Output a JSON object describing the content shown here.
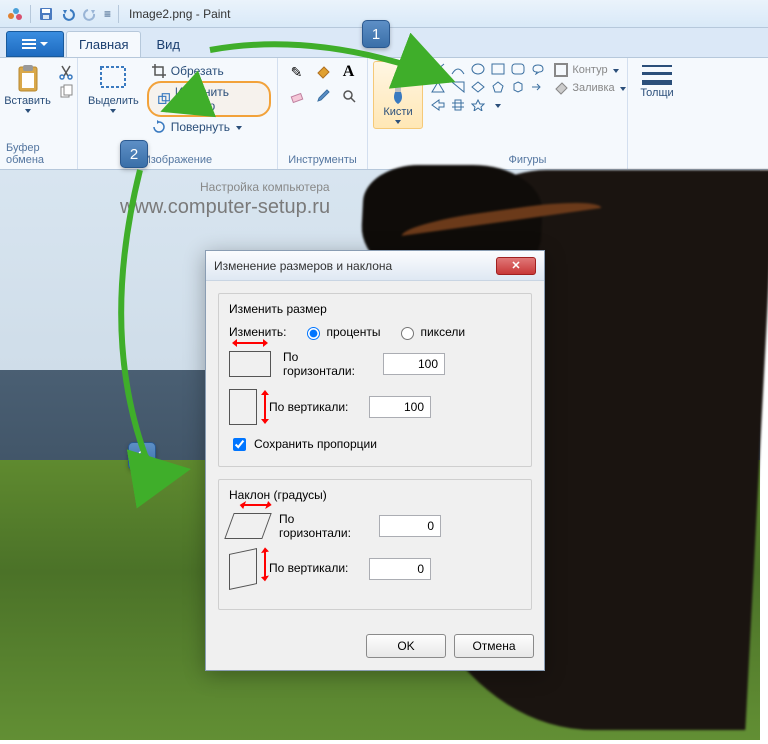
{
  "titlebar": {
    "filename": "Image2.png",
    "app": "Paint"
  },
  "tabs": {
    "home": "Главная",
    "view": "Вид"
  },
  "ribbon": {
    "clipboard": {
      "paste": "Вставить",
      "group": "Буфер обмена"
    },
    "image": {
      "select": "Выделить",
      "crop": "Обрезать",
      "resize": "Изменить размер",
      "rotate": "Повернуть",
      "group": "Изображение"
    },
    "tools": {
      "group": "Инструменты"
    },
    "brushes": {
      "label": "Кисти"
    },
    "shapes": {
      "outline": "Контур",
      "fill": "Заливка",
      "group": "Фигуры"
    },
    "thickness": {
      "label": "Толщи"
    }
  },
  "watermark": {
    "small": "Настройка компьютера",
    "main": "www.computer-setup.ru"
  },
  "dialog": {
    "title": "Изменение размеров и наклона",
    "resize_section": "Изменить размер",
    "change_label": "Изменить:",
    "percent": "проценты",
    "pixels": "пиксели",
    "horizontal": "По горизонтали:",
    "vertical": "По вертикали:",
    "h_value": "100",
    "v_value": "100",
    "keep_ratio": "Сохранить пропорции",
    "skew_section": "Наклон (градусы)",
    "skew_h_value": "0",
    "skew_v_value": "0",
    "ok": "OK",
    "cancel": "Отмена"
  },
  "callouts": {
    "c1": "1",
    "c2": "2",
    "c3": "3"
  }
}
